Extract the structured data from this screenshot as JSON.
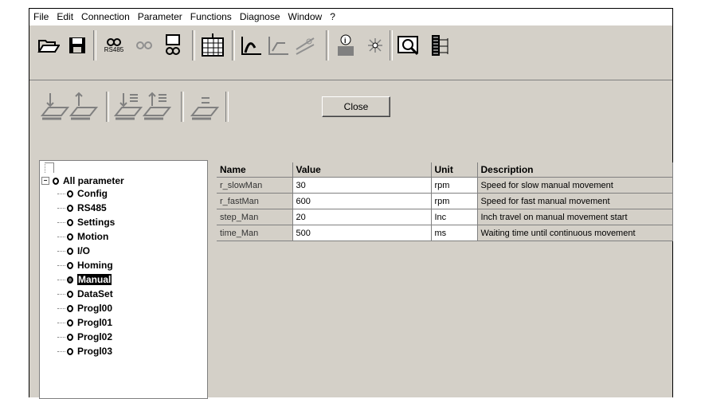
{
  "menu": [
    "File",
    "Edit",
    "Connection",
    "Parameter",
    "Functions",
    "Diagnose",
    "Window",
    "?"
  ],
  "toolbar": {
    "rs485_label": "RS485",
    "close_label": "Close"
  },
  "tree": {
    "root": "All parameter",
    "items": [
      "Config",
      "RS485",
      "Settings",
      "Motion",
      "I/O",
      "Homing",
      "Manual",
      "DataSet",
      "Progl00",
      "Progl01",
      "Progl02",
      "Progl03"
    ],
    "selected": "Manual"
  },
  "table": {
    "headers": [
      "Name",
      "Value",
      "Unit",
      "Description"
    ],
    "rows": [
      [
        "r_slowMan",
        "30",
        "rpm",
        "Speed for slow manual movement"
      ],
      [
        "r_fastMan",
        "600",
        "rpm",
        "Speed for fast manual movement"
      ],
      [
        "step_Man",
        "20",
        "Inc",
        "Inch travel on manual movement start"
      ],
      [
        "time_Man",
        "500",
        "ms",
        "Waiting time until continuous movement"
      ]
    ]
  }
}
